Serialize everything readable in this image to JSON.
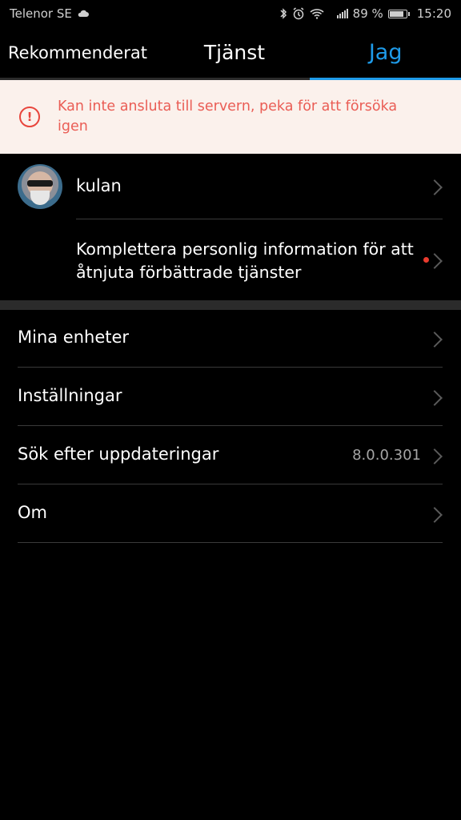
{
  "status_bar": {
    "carrier": "Telenor SE",
    "battery": "89 %",
    "battery_level": 0.89,
    "time": "15:20",
    "icons": [
      "cloud-icon",
      "bluetooth-icon",
      "alarm-icon",
      "wifi-icon",
      "signal-icon",
      "battery-icon"
    ]
  },
  "tabs": [
    {
      "label": "Rekommenderat",
      "active": false
    },
    {
      "label": "Tjänst",
      "active": false
    },
    {
      "label": "Jag",
      "active": true
    }
  ],
  "error_banner": {
    "icon": "alert-circle-icon",
    "text": "Kan inte ansluta till servern, peka för att försöka igen"
  },
  "profile": {
    "username": "kulan",
    "info_prompt": "Komplettera personlig information för att åtnjuta förbättrade tjänster"
  },
  "menu": {
    "devices": "Mina enheter",
    "settings": "Inställningar",
    "updates": "Sök efter uppdateringar",
    "version": "8.0.0.301",
    "about": "Om"
  },
  "colors": {
    "accent": "#1e9be9",
    "error_text": "#ea5d55",
    "error_bg": "#fbf1ec",
    "background": "#000000"
  }
}
